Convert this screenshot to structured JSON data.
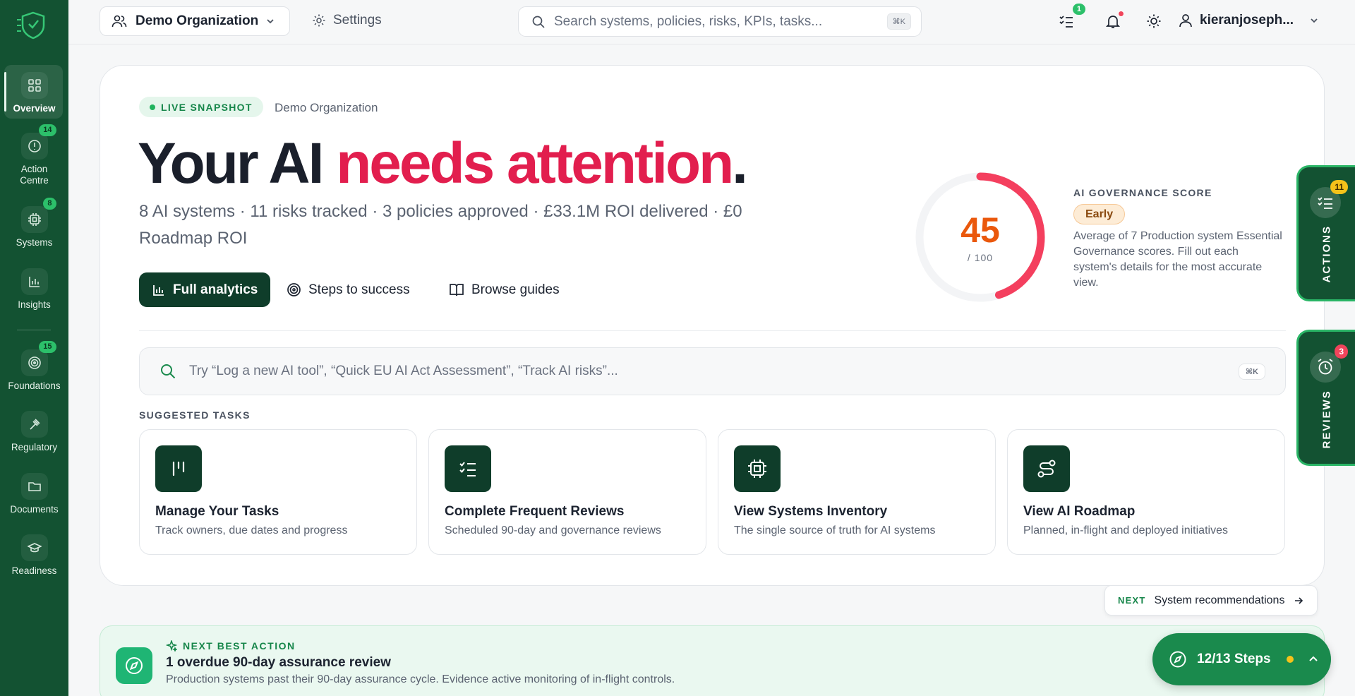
{
  "sidebar": {
    "items": [
      {
        "label": "Overview",
        "badge": ""
      },
      {
        "label": "Action Centre",
        "badge": "14"
      },
      {
        "label": "Systems",
        "badge": "8"
      },
      {
        "label": "Insights",
        "badge": ""
      },
      {
        "label": "Foundations",
        "badge": "15"
      },
      {
        "label": "Regulatory",
        "badge": ""
      },
      {
        "label": "Documents",
        "badge": ""
      },
      {
        "label": "Readiness",
        "badge": ""
      }
    ]
  },
  "topbar": {
    "org_name": "Demo Organization",
    "settings_label": "Settings",
    "search_placeholder": "Search systems, policies, risks, KPIs, tasks...",
    "search_shortcut": "⌘K",
    "tasks_badge": "1",
    "username": "kieranjoseph..."
  },
  "hero": {
    "live_label": "LIVE SNAPSHOT",
    "org_name": "Demo Organization",
    "headline_a": "Your AI ",
    "headline_b": "needs attention",
    "headline_c": ".",
    "summary": "8 AI systems · 11 risks tracked · 3 policies approved · £33.1M ROI delivered · £0 Roadmap ROI",
    "btn_analytics": "Full analytics",
    "btn_steps": "Steps to success",
    "btn_guides": "Browse guides",
    "score": {
      "value": "45",
      "max": "/ 100",
      "fraction": 0.45,
      "title": "AI GOVERNANCE SCORE",
      "badge": "Early",
      "description": "Average of 7 Production system Essential Governance scores. Fill out each system's details for the most accurate view."
    },
    "cmd_placeholder": "Try “Log a new AI tool”, “Quick EU AI Act Assessment”, “Track AI risks”...",
    "cmd_shortcut": "⌘K",
    "suggested_title": "SUGGESTED TASKS",
    "tasks": [
      {
        "title": "Manage Your Tasks",
        "subtitle": "Track owners, due dates and progress"
      },
      {
        "title": "Complete Frequent Reviews",
        "subtitle": "Scheduled 90-day and governance reviews"
      },
      {
        "title": "View Systems Inventory",
        "subtitle": "The single source of truth for AI systems"
      },
      {
        "title": "View AI Roadmap",
        "subtitle": "Planned, in-flight and deployed initiatives"
      }
    ]
  },
  "side_tabs": {
    "actions": {
      "label": "ACTIONS",
      "badge": "11"
    },
    "reviews": {
      "label": "REVIEWS",
      "badge": "3"
    }
  },
  "next_rec": {
    "prefix": "NEXT",
    "label": "System recommendations"
  },
  "next_best_action": {
    "label": "NEXT BEST ACTION",
    "title": "1 overdue 90-day assurance review",
    "subtitle": "Production systems past their 90-day assurance cycle. Evidence active monitoring of in-flight controls."
  },
  "steps": {
    "label": "12/13 Steps"
  },
  "colors": {
    "brand": "#135232",
    "accent": "#e21e4e",
    "score": "#ea580c",
    "success": "#2cc06a"
  }
}
